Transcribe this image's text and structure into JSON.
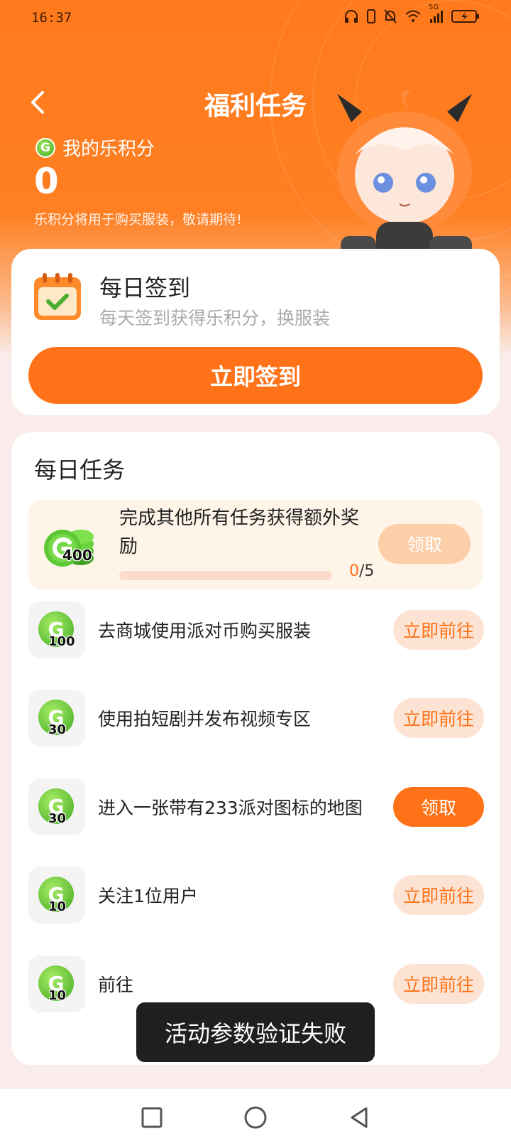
{
  "status_bar": {
    "time": "16:37",
    "network": "5G"
  },
  "header": {
    "title": "福利任务"
  },
  "points": {
    "label": "我的乐积分",
    "value": "0",
    "tip": "乐积分将用于购买服装，敬请期待!",
    "coin_letter": "G"
  },
  "signin": {
    "title": "每日签到",
    "subtitle": "每天签到获得乐积分，换服装",
    "button": "立即签到"
  },
  "tasks": {
    "title": "每日任务",
    "bonus": {
      "text": "完成其他所有任务获得额外奖励",
      "coins": "400",
      "progress_done": "0",
      "progress_total": "/5",
      "progress_fraction": 0,
      "button": "领取"
    },
    "items": [
      {
        "coins": "100",
        "label": "去商城使用派对币购买服装",
        "button": "立即前往"
      },
      {
        "coins": "30",
        "label": "使用拍短剧并发布视频专区",
        "button": "立即前往"
      },
      {
        "coins": "30",
        "label": "进入一张带有233派对图标的地图",
        "button": "领取"
      },
      {
        "coins": "10",
        "label": "关注1位用户",
        "button": "立即前往"
      },
      {
        "coins": "10",
        "label": "前往",
        "button": "立即前往"
      }
    ]
  },
  "toast": {
    "text": "活动参数验证失败"
  },
  "colors": {
    "accent": "#ff7217",
    "coin_green": "#45b226"
  }
}
